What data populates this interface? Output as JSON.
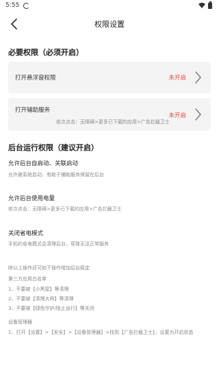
{
  "status_bar": {
    "time": "5:55"
  },
  "header": {
    "title": "权限设置"
  },
  "required": {
    "title": "必要权限（必须开启）",
    "items": [
      {
        "label": "打开悬浮窗权限",
        "status": "未开启",
        "sub": ""
      },
      {
        "label": "打开辅助服务",
        "status": "未开启",
        "sub": "依次点击：无障碍>更多已下载的应用>广告拦截卫士"
      }
    ]
  },
  "background": {
    "title": "后台运行权限（建议开启）",
    "items": [
      {
        "label": "允许后台自启动、关联启动",
        "desc": "允许被系统启动，有助于辅助服务保留在后台"
      },
      {
        "label": "允许后台使用电量",
        "desc": "依次点击：无障碍>更多已下载的应用>广告拦截卫士"
      },
      {
        "label": "关闭省电模式",
        "desc": "手机的省电模式会清理后台，导致无法正常服务"
      }
    ]
  },
  "notes": {
    "intro": "除以上操作还可如下操作增加后台稳定",
    "whitelist_title": "第三方应用白名单",
    "whitelist": [
      "1、不要被【小黑屋】等清理",
      "2、不要被【清理大师】等清理",
      "3、不要被【绿色守护/阻止运行】等关闭"
    ],
    "device_admin_title": "设备管理器",
    "device_admin_step": "1、打开【设置】>【安全】>【设备管理器】>找到【广告拦截卫士】，设置为开启状态"
  },
  "colors": {
    "warning": "#e84a3f",
    "card_bg": "#f4f4f4"
  }
}
